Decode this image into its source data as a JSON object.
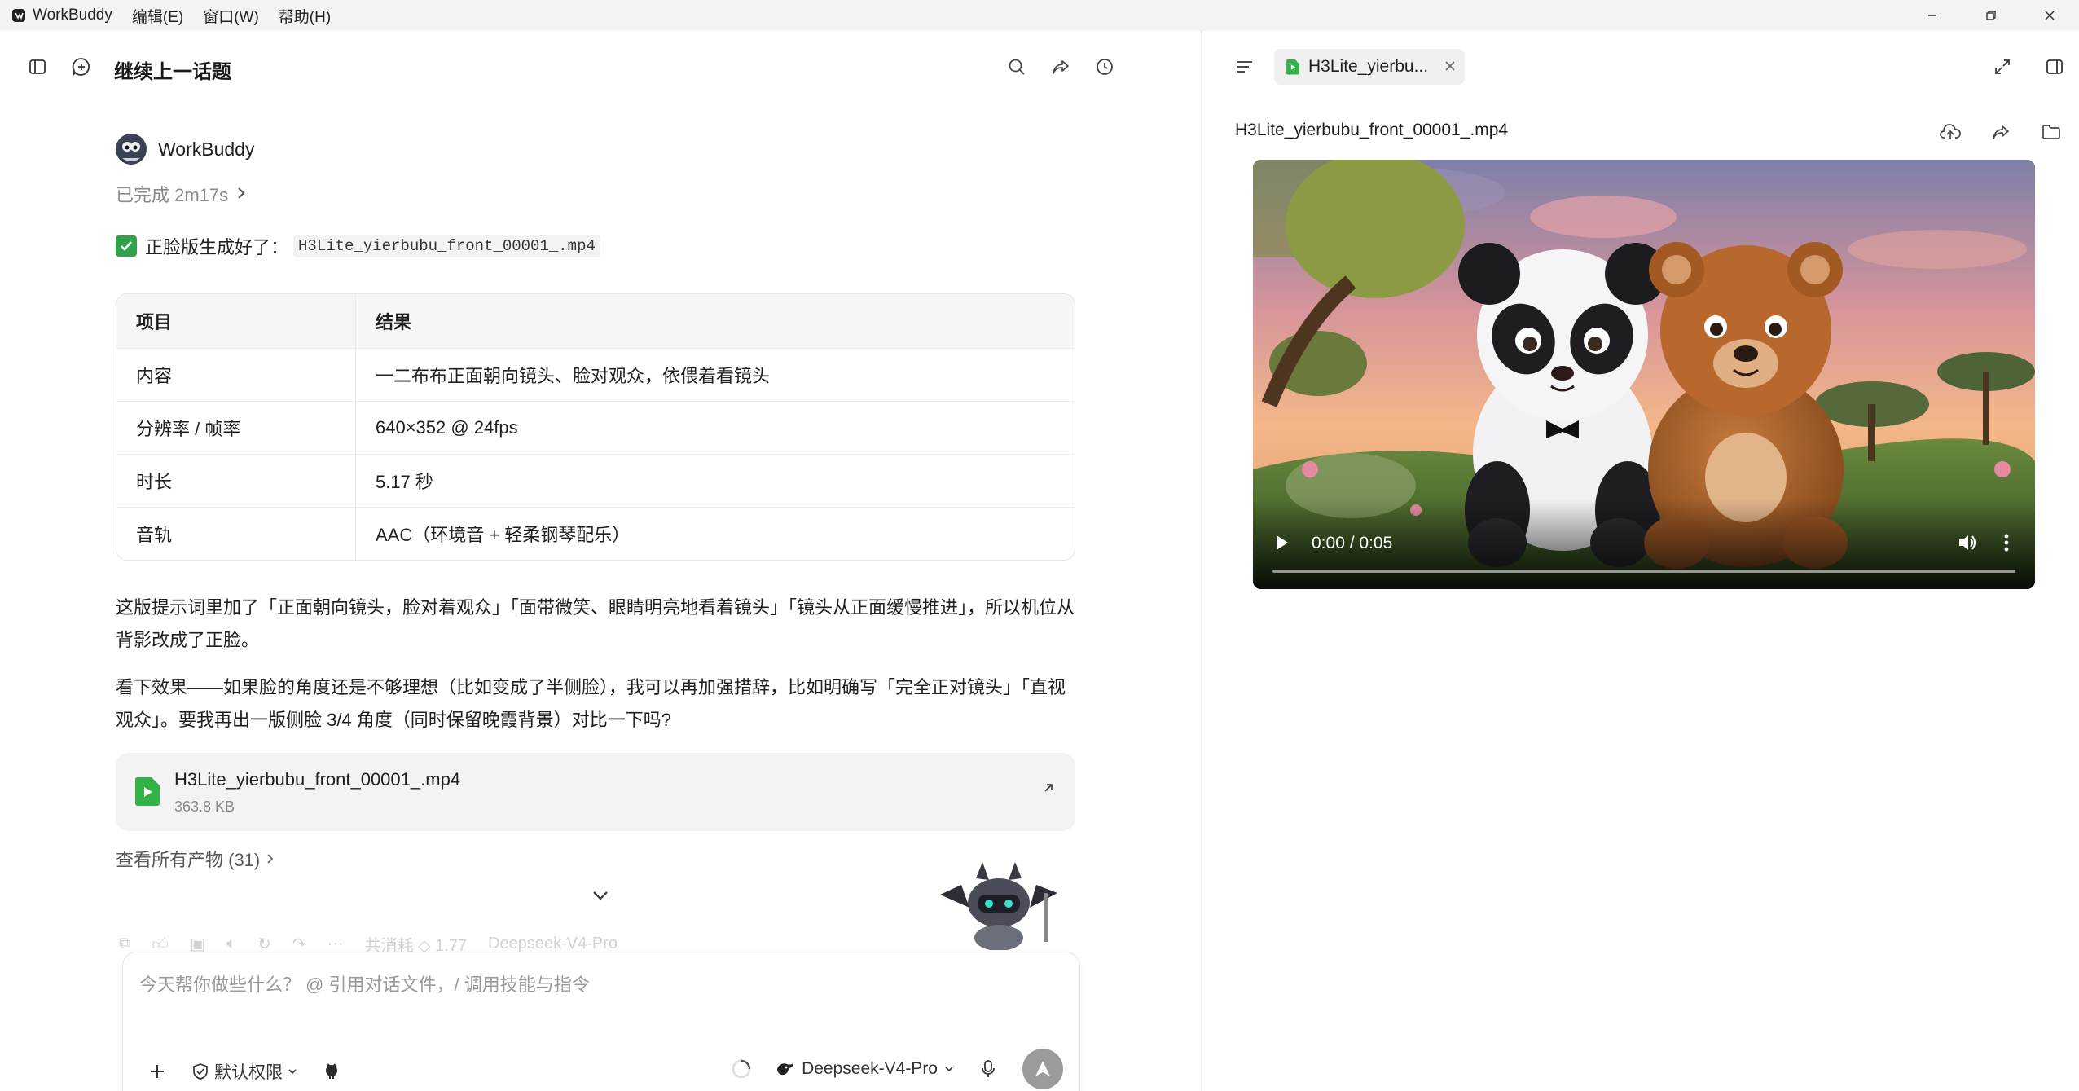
{
  "titlebar": {
    "app_name": "WorkBuddy",
    "menu": [
      "编辑(E)",
      "窗口(W)",
      "帮助(H)"
    ]
  },
  "left": {
    "page_title": "继续上一话题",
    "message": {
      "sender": "WorkBuddy",
      "status": "已完成 2m17s",
      "result_label": "正脸版生成好了：",
      "result_file": "H3Lite_yierbubu_front_00001_.mp4",
      "table": {
        "headers": [
          "项目",
          "结果"
        ],
        "rows": [
          [
            "内容",
            "一二布布正面朝向镜头、脸对观众，依偎着看镜头"
          ],
          [
            "分辨率 / 帧率",
            "640×352 @ 24fps"
          ],
          [
            "时长",
            "5.17 秒"
          ],
          [
            "音轨",
            "AAC（环境音 + 轻柔钢琴配乐）"
          ]
        ]
      },
      "paragraph1": "这版提示词里加了「正面朝向镜头，脸对着观众」「面带微笑、眼睛明亮地看着镜头」「镜头从正面缓慢推进」，所以机位从背影改成了正脸。",
      "paragraph2": "看下效果——如果脸的角度还是不够理想（比如变成了半侧脸），我可以再加强措辞，比如明确写「完全正对镜头」「直视观众」。要我再出一版侧脸 3/4 角度（同时保留晚霞背景）对比一下吗?",
      "attachment": {
        "name": "H3Lite_yierbubu_front_00001_.mp4",
        "size": "363.8 KB"
      },
      "artifacts_link": "查看所有产物 (31)",
      "faded_meta": {
        "credits": "共消耗 ◇ 1.77",
        "model": "Deepseek-V4-Pro"
      }
    },
    "composer": {
      "placeholder": "今天帮你做些什么？ @ 引用对话文件，/ 调用技能与指令",
      "permission": "默认权限",
      "model": "Deepseek-V4-Pro"
    }
  },
  "right": {
    "tab_label": "H3Lite_yierbu...",
    "file_title": "H3Lite_yierbubu_front_00001_.mp4",
    "video": {
      "time": "0:00 / 0:05",
      "progress": 0
    }
  },
  "colors": {
    "accent_green": "#2fa24a",
    "send_button": "#9b9b9b"
  }
}
